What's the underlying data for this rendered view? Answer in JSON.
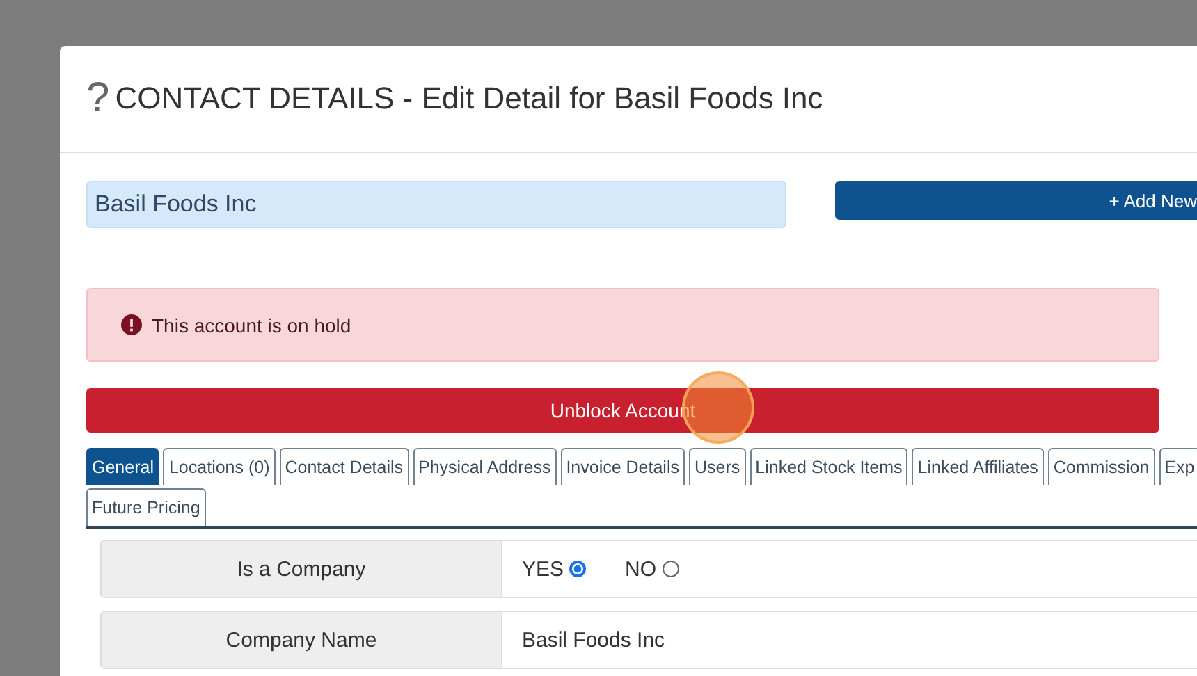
{
  "modal": {
    "help_icon": "?",
    "title": "CONTACT DETAILS - Edit Detail for Basil Foods Inc"
  },
  "account_field": {
    "value": "Basil Foods Inc"
  },
  "add_button": {
    "label": "+ Add New"
  },
  "alert": {
    "text": "This account is on hold"
  },
  "unblock_button": {
    "label": "Unblock Account"
  },
  "tab_rows": [
    [
      {
        "label": "General",
        "selected": true
      },
      {
        "label": "Locations (0)",
        "selected": false
      },
      {
        "label": "Contact Details",
        "selected": false
      },
      {
        "label": "Physical Address",
        "selected": false
      },
      {
        "label": "Invoice Details",
        "selected": false
      },
      {
        "label": "Users",
        "selected": false
      },
      {
        "label": "Linked Stock Items",
        "selected": false
      },
      {
        "label": "Linked Affiliates",
        "selected": false
      },
      {
        "label": "Commission",
        "selected": false
      },
      {
        "label": "Exp",
        "selected": false
      }
    ],
    [
      {
        "label": "Future Pricing",
        "selected": false
      }
    ]
  ],
  "form_rows": [
    {
      "kind": "radio",
      "label": "Is a Company",
      "options": [
        {
          "label": "YES",
          "selected": true
        },
        {
          "label": "NO",
          "selected": false
        }
      ]
    },
    {
      "kind": "text",
      "label": "Company Name",
      "value": "Basil Foods Inc"
    }
  ]
}
